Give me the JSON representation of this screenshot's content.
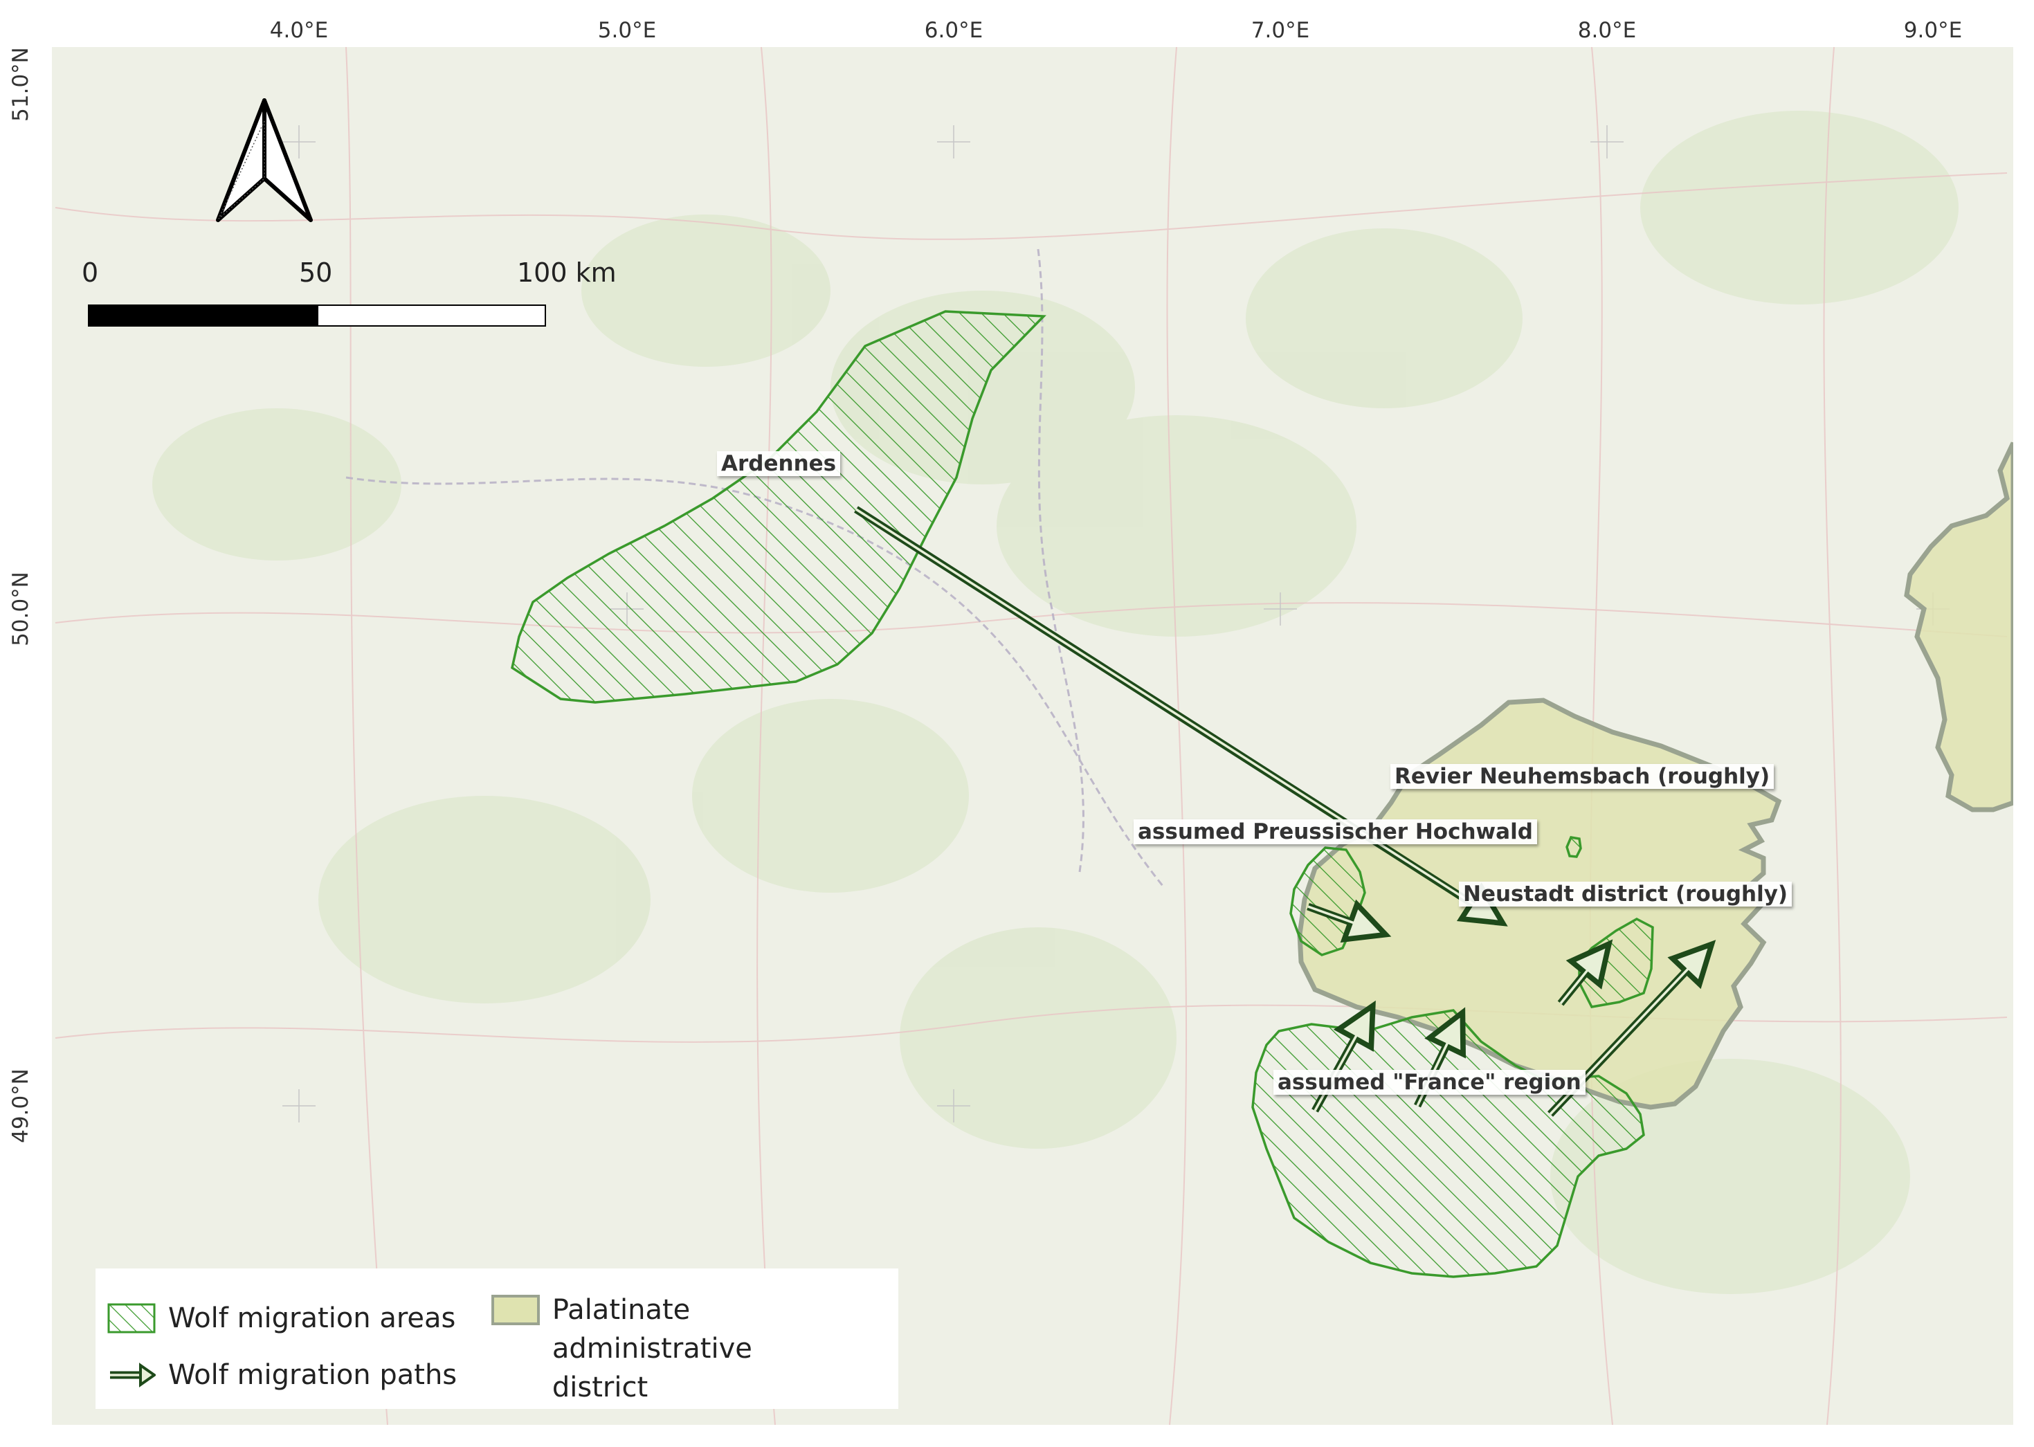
{
  "axes": {
    "longitude_ticks": [
      "4.0°E",
      "5.0°E",
      "6.0°E",
      "7.0°E",
      "8.0°E",
      "9.0°E"
    ],
    "latitude_ticks": [
      "51.0°N",
      "50.0°N",
      "49.0°N"
    ]
  },
  "scalebar": {
    "labels": [
      "0",
      "50",
      "100 km"
    ]
  },
  "labels": {
    "ardennes": "Ardennes",
    "neuhemsbach": "Revier Neuhemsbach (roughly)",
    "hochwald": "assumed Preussischer Hochwald",
    "neustadt": "Neustadt district (roughly)",
    "france": "assumed \"France\" region"
  },
  "legend": {
    "areas": "Wolf migration areas",
    "paths": "Wolf migration paths",
    "district_line1": "Palatinate administrative",
    "district_line2": "district"
  },
  "colors": {
    "area_green": "#3a9a2c",
    "path_green": "#1e4a1a",
    "district_fill": "#dfe3b0",
    "district_border": "#9aa390"
  }
}
